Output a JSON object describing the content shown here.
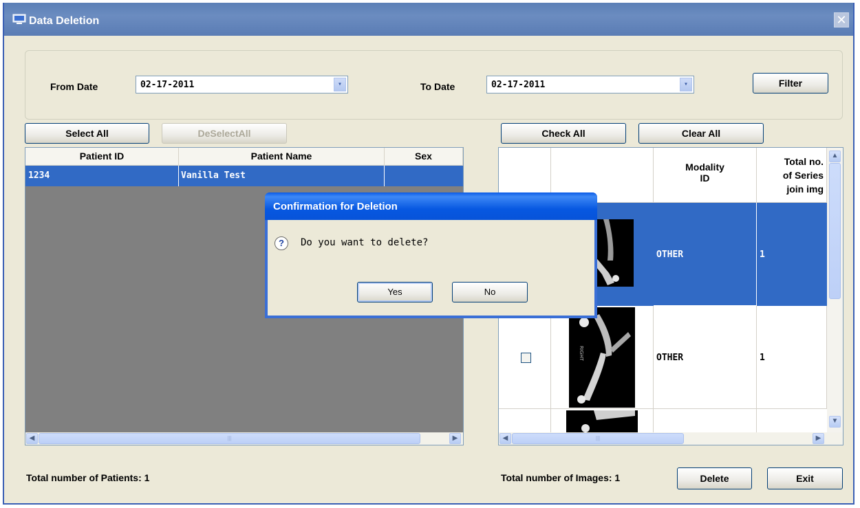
{
  "window": {
    "title": "Data Deletion",
    "close_glyph": "✕"
  },
  "filter": {
    "from_label": "From Date",
    "from_value": "02-17-2011",
    "to_label": "To Date",
    "to_value": "02-17-2011",
    "filter_button": "Filter",
    "dropdown_glyph": "▾"
  },
  "patients": {
    "select_all": "Select All",
    "deselect_all": "DeSelectAll",
    "columns": [
      "Patient ID",
      "Patient Name",
      "Sex"
    ],
    "rows": [
      {
        "id": "1234",
        "name": "Vanilla Test",
        "sex": ""
      }
    ],
    "footer": "Total number of Patients: 1"
  },
  "images": {
    "check_all": "Check All",
    "clear_all": "Clear All",
    "columns": [
      "",
      "",
      "Modality ID",
      "Total no. of Series join img"
    ],
    "column_modality_line1": "Modality",
    "column_modality_line2": "ID",
    "column_total_line1": "Total no.",
    "column_total_line2": "of Series",
    "column_total_line3": "join img",
    "rows": [
      {
        "checked": false,
        "thumbnail": "x-ray-thumbnail",
        "modality": "OTHER",
        "total": "1",
        "selected": true
      },
      {
        "checked": false,
        "thumbnail": "x-ray-thumbnail",
        "modality": "OTHER",
        "total": "1",
        "selected": false
      }
    ],
    "footer": "Total number of Images: 1",
    "xray_marker": "RIGHT"
  },
  "actions": {
    "delete": "Delete",
    "exit": "Exit"
  },
  "scrollbar": {
    "left": "◀",
    "right": "▶",
    "up": "▲",
    "down": "▼",
    "grip": "|||"
  },
  "dialog": {
    "title": "Confirmation for Deletion",
    "message": "Do you want to delete?",
    "yes": "Yes",
    "no": "No",
    "icon": "question-icon",
    "icon_glyph": "?"
  }
}
